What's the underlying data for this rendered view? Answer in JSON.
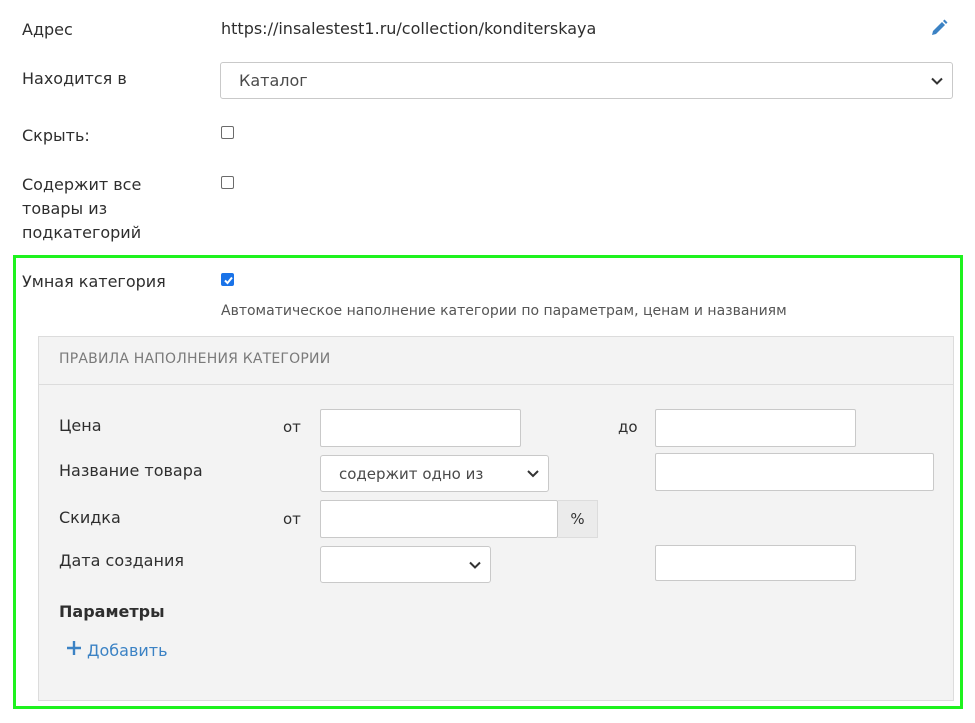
{
  "fields": {
    "address": {
      "label": "Адрес",
      "value": "https://insalestest1.ru/collection/konditerskaya",
      "edit_icon": "pencil-icon"
    },
    "parent": {
      "label": "Находится в",
      "selected": "Каталог"
    },
    "hide": {
      "label": "Скрыть:",
      "checked": false
    },
    "subcategories": {
      "label_line1": "Содержит все",
      "label_line2": "товары из",
      "label_line3": "подкатегорий",
      "checked": false
    },
    "smart": {
      "label": "Умная категория",
      "checked": true,
      "hint": "Автоматическое наполнение категории по параметрам, ценам и названиям"
    }
  },
  "rules": {
    "title": "ПРАВИЛА НАПОЛНЕНИЯ КАТЕГОРИИ",
    "price": {
      "label": "Цена",
      "from": "от",
      "to": "до",
      "from_value": "",
      "to_value": ""
    },
    "name": {
      "label": "Название товара",
      "selected": "содержит одно из",
      "value": ""
    },
    "discount": {
      "label": "Скидка",
      "from": "от",
      "value": "",
      "unit": "%"
    },
    "created": {
      "label": "Дата создания",
      "selected": "",
      "value": ""
    },
    "params": {
      "label": "Параметры",
      "add_label": "Добавить"
    }
  },
  "colors": {
    "highlight": "#1ef21e",
    "accent": "#1a73e8",
    "link": "#3b82c4"
  }
}
